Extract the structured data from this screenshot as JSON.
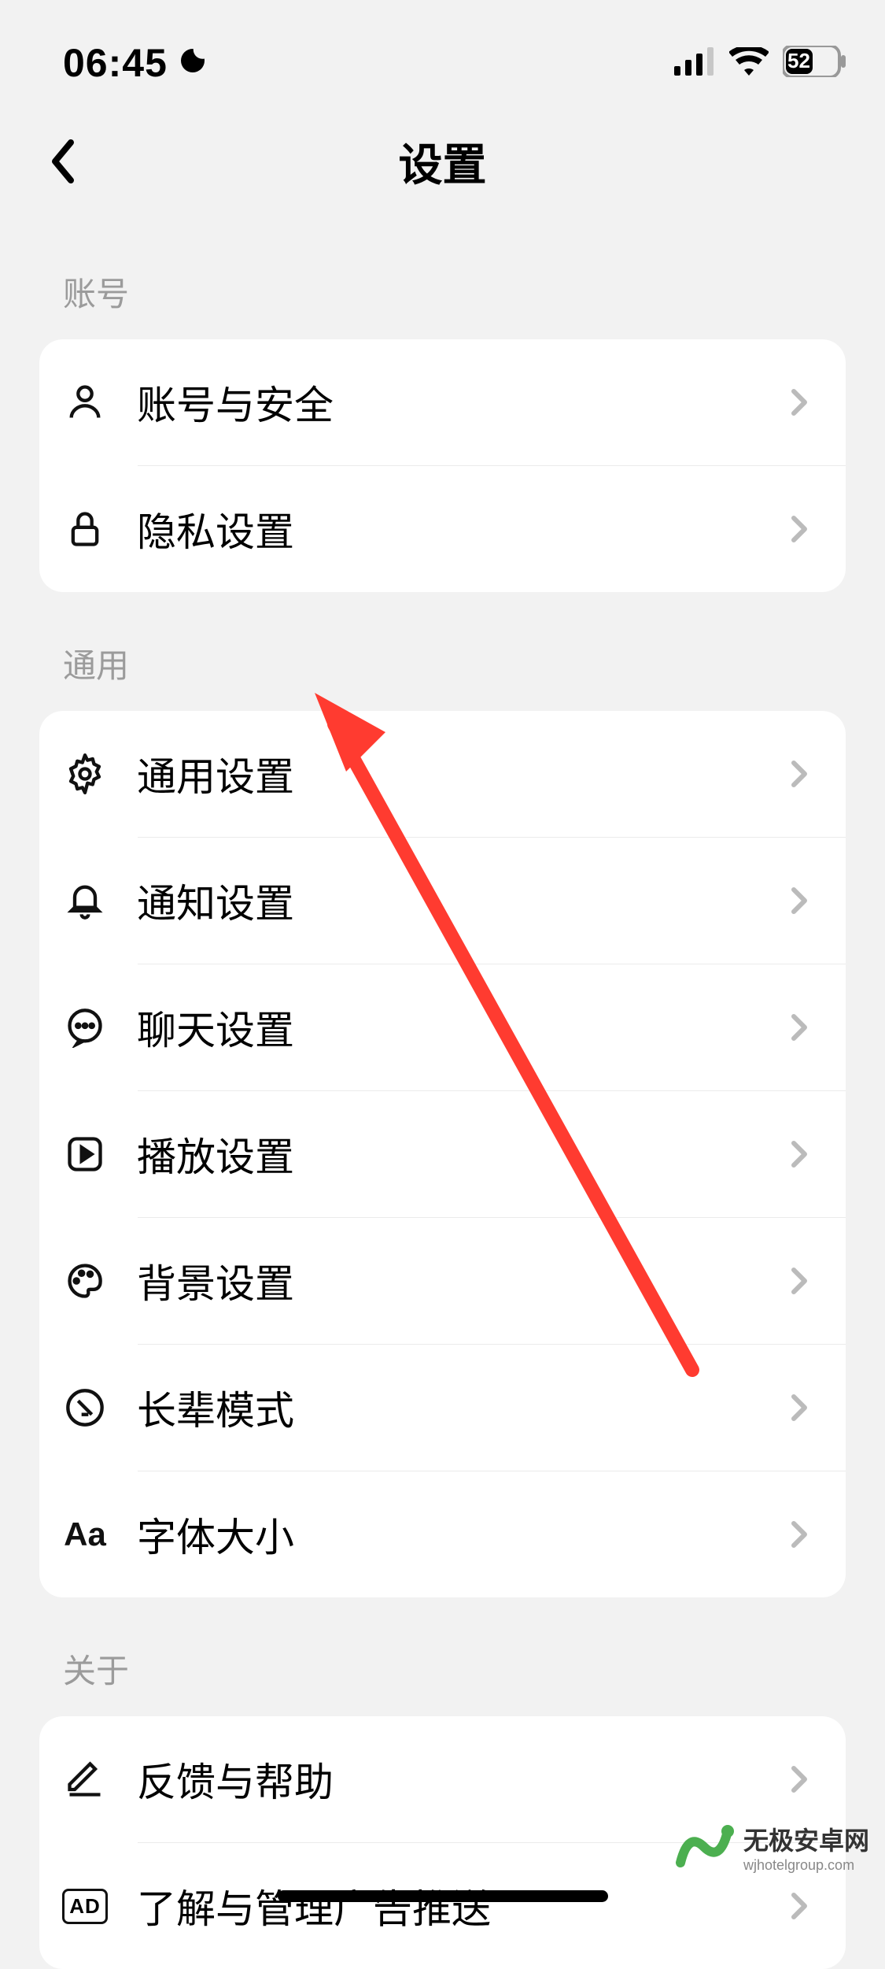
{
  "status_bar": {
    "time": "06:45",
    "battery": "52"
  },
  "header": {
    "title": "设置"
  },
  "sections": {
    "account": {
      "header": "账号",
      "items": [
        {
          "label": "账号与安全"
        },
        {
          "label": "隐私设置"
        }
      ]
    },
    "general": {
      "header": "通用",
      "items": [
        {
          "label": "通用设置"
        },
        {
          "label": "通知设置"
        },
        {
          "label": "聊天设置"
        },
        {
          "label": "播放设置"
        },
        {
          "label": "背景设置"
        },
        {
          "label": "长辈模式"
        },
        {
          "label": "字体大小"
        }
      ]
    },
    "about": {
      "header": "关于",
      "items": [
        {
          "label": "反馈与帮助"
        },
        {
          "label": "了解与管理广告推送"
        }
      ]
    }
  },
  "watermark": {
    "title": "无极安卓网",
    "sub": "wjhotelgroup.com"
  }
}
